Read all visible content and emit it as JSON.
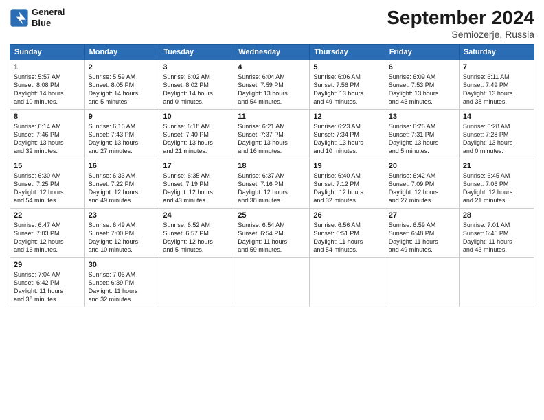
{
  "header": {
    "logo_line1": "General",
    "logo_line2": "Blue",
    "title": "September 2024",
    "location": "Semiozerje, Russia"
  },
  "days_of_week": [
    "Sunday",
    "Monday",
    "Tuesday",
    "Wednesday",
    "Thursday",
    "Friday",
    "Saturday"
  ],
  "weeks": [
    [
      {
        "day": "1",
        "info": "Sunrise: 5:57 AM\nSunset: 8:08 PM\nDaylight: 14 hours\nand 10 minutes."
      },
      {
        "day": "2",
        "info": "Sunrise: 5:59 AM\nSunset: 8:05 PM\nDaylight: 14 hours\nand 5 minutes."
      },
      {
        "day": "3",
        "info": "Sunrise: 6:02 AM\nSunset: 8:02 PM\nDaylight: 14 hours\nand 0 minutes."
      },
      {
        "day": "4",
        "info": "Sunrise: 6:04 AM\nSunset: 7:59 PM\nDaylight: 13 hours\nand 54 minutes."
      },
      {
        "day": "5",
        "info": "Sunrise: 6:06 AM\nSunset: 7:56 PM\nDaylight: 13 hours\nand 49 minutes."
      },
      {
        "day": "6",
        "info": "Sunrise: 6:09 AM\nSunset: 7:53 PM\nDaylight: 13 hours\nand 43 minutes."
      },
      {
        "day": "7",
        "info": "Sunrise: 6:11 AM\nSunset: 7:49 PM\nDaylight: 13 hours\nand 38 minutes."
      }
    ],
    [
      {
        "day": "8",
        "info": "Sunrise: 6:14 AM\nSunset: 7:46 PM\nDaylight: 13 hours\nand 32 minutes."
      },
      {
        "day": "9",
        "info": "Sunrise: 6:16 AM\nSunset: 7:43 PM\nDaylight: 13 hours\nand 27 minutes."
      },
      {
        "day": "10",
        "info": "Sunrise: 6:18 AM\nSunset: 7:40 PM\nDaylight: 13 hours\nand 21 minutes."
      },
      {
        "day": "11",
        "info": "Sunrise: 6:21 AM\nSunset: 7:37 PM\nDaylight: 13 hours\nand 16 minutes."
      },
      {
        "day": "12",
        "info": "Sunrise: 6:23 AM\nSunset: 7:34 PM\nDaylight: 13 hours\nand 10 minutes."
      },
      {
        "day": "13",
        "info": "Sunrise: 6:26 AM\nSunset: 7:31 PM\nDaylight: 13 hours\nand 5 minutes."
      },
      {
        "day": "14",
        "info": "Sunrise: 6:28 AM\nSunset: 7:28 PM\nDaylight: 13 hours\nand 0 minutes."
      }
    ],
    [
      {
        "day": "15",
        "info": "Sunrise: 6:30 AM\nSunset: 7:25 PM\nDaylight: 12 hours\nand 54 minutes."
      },
      {
        "day": "16",
        "info": "Sunrise: 6:33 AM\nSunset: 7:22 PM\nDaylight: 12 hours\nand 49 minutes."
      },
      {
        "day": "17",
        "info": "Sunrise: 6:35 AM\nSunset: 7:19 PM\nDaylight: 12 hours\nand 43 minutes."
      },
      {
        "day": "18",
        "info": "Sunrise: 6:37 AM\nSunset: 7:16 PM\nDaylight: 12 hours\nand 38 minutes."
      },
      {
        "day": "19",
        "info": "Sunrise: 6:40 AM\nSunset: 7:12 PM\nDaylight: 12 hours\nand 32 minutes."
      },
      {
        "day": "20",
        "info": "Sunrise: 6:42 AM\nSunset: 7:09 PM\nDaylight: 12 hours\nand 27 minutes."
      },
      {
        "day": "21",
        "info": "Sunrise: 6:45 AM\nSunset: 7:06 PM\nDaylight: 12 hours\nand 21 minutes."
      }
    ],
    [
      {
        "day": "22",
        "info": "Sunrise: 6:47 AM\nSunset: 7:03 PM\nDaylight: 12 hours\nand 16 minutes."
      },
      {
        "day": "23",
        "info": "Sunrise: 6:49 AM\nSunset: 7:00 PM\nDaylight: 12 hours\nand 10 minutes."
      },
      {
        "day": "24",
        "info": "Sunrise: 6:52 AM\nSunset: 6:57 PM\nDaylight: 12 hours\nand 5 minutes."
      },
      {
        "day": "25",
        "info": "Sunrise: 6:54 AM\nSunset: 6:54 PM\nDaylight: 11 hours\nand 59 minutes."
      },
      {
        "day": "26",
        "info": "Sunrise: 6:56 AM\nSunset: 6:51 PM\nDaylight: 11 hours\nand 54 minutes."
      },
      {
        "day": "27",
        "info": "Sunrise: 6:59 AM\nSunset: 6:48 PM\nDaylight: 11 hours\nand 49 minutes."
      },
      {
        "day": "28",
        "info": "Sunrise: 7:01 AM\nSunset: 6:45 PM\nDaylight: 11 hours\nand 43 minutes."
      }
    ],
    [
      {
        "day": "29",
        "info": "Sunrise: 7:04 AM\nSunset: 6:42 PM\nDaylight: 11 hours\nand 38 minutes."
      },
      {
        "day": "30",
        "info": "Sunrise: 7:06 AM\nSunset: 6:39 PM\nDaylight: 11 hours\nand 32 minutes."
      },
      {
        "day": "",
        "info": "",
        "empty": true
      },
      {
        "day": "",
        "info": "",
        "empty": true
      },
      {
        "day": "",
        "info": "",
        "empty": true
      },
      {
        "day": "",
        "info": "",
        "empty": true
      },
      {
        "day": "",
        "info": "",
        "empty": true
      }
    ]
  ]
}
